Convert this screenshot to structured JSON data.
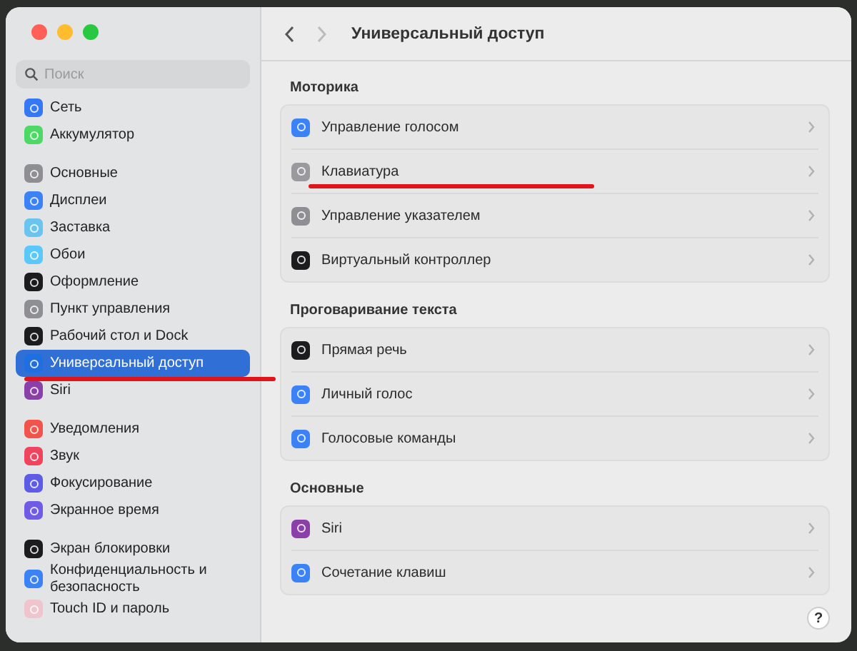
{
  "window": {
    "title": "Универсальный доступ"
  },
  "nav": {
    "back_disabled": false,
    "forward_disabled": true
  },
  "sidebar": {
    "search": {
      "placeholder": "Поиск"
    },
    "groups": [
      [
        {
          "label": "Сеть",
          "selected": false,
          "underlined": false,
          "color": "#3478f6"
        },
        {
          "label": "Аккумулятор",
          "selected": false,
          "underlined": false,
          "color": "#4cd964"
        }
      ],
      [
        {
          "label": "Основные",
          "selected": false,
          "underlined": false,
          "color": "#8e8e93"
        },
        {
          "label": "Дисплеи",
          "selected": false,
          "underlined": false,
          "color": "#3b82f6"
        },
        {
          "label": "Заставка",
          "selected": false,
          "underlined": false,
          "color": "#6ac4f0"
        },
        {
          "label": "Обои",
          "selected": false,
          "underlined": false,
          "color": "#5ac8fa"
        },
        {
          "label": "Оформление",
          "selected": false,
          "underlined": false,
          "color": "#1c1c1e"
        },
        {
          "label": "Пункт управления",
          "selected": false,
          "underlined": false,
          "color": "#8e8e93"
        },
        {
          "label": "Рабочий стол и Dock",
          "selected": false,
          "underlined": false,
          "color": "#1c1c1e"
        },
        {
          "label": "Универсальный доступ",
          "selected": true,
          "underlined": true,
          "color": "#1f6fe0"
        },
        {
          "label": "Siri",
          "selected": false,
          "underlined": false,
          "color": "#8b3fa8"
        }
      ],
      [
        {
          "label": "Уведомления",
          "selected": false,
          "underlined": false,
          "color": "#f2534b"
        },
        {
          "label": "Звук",
          "selected": false,
          "underlined": false,
          "color": "#f0435e"
        },
        {
          "label": "Фокусирование",
          "selected": false,
          "underlined": false,
          "color": "#5e5ce6"
        },
        {
          "label": "Экранное время",
          "selected": false,
          "underlined": false,
          "color": "#6e5ce6"
        }
      ],
      [
        {
          "label": "Экран блокировки",
          "selected": false,
          "underlined": false,
          "color": "#1c1c1e"
        },
        {
          "label": "Конфиденциальность и безопасность",
          "selected": false,
          "underlined": false,
          "color": "#3b82f6"
        },
        {
          "label": "Touch ID и пароль",
          "selected": false,
          "underlined": false,
          "color": "#f0c4cc"
        }
      ]
    ]
  },
  "sections": [
    {
      "title": "Моторика",
      "rows": [
        {
          "label": "Управление голосом",
          "underlined": false,
          "color": "#3b82f6"
        },
        {
          "label": "Клавиатура",
          "underlined": true,
          "color": "#9a9a9e"
        },
        {
          "label": "Управление указателем",
          "underlined": false,
          "color": "#8e8e93"
        },
        {
          "label": "Виртуальный контроллер",
          "underlined": false,
          "color": "#1c1c1e"
        }
      ]
    },
    {
      "title": "Проговаривание текста",
      "rows": [
        {
          "label": "Прямая речь",
          "underlined": false,
          "color": "#1c1c1e"
        },
        {
          "label": "Личный голос",
          "underlined": false,
          "color": "#3b82f6"
        },
        {
          "label": "Голосовые команды",
          "underlined": false,
          "color": "#3b82f6"
        }
      ]
    },
    {
      "title": "Основные",
      "rows": [
        {
          "label": "Siri",
          "underlined": false,
          "color": "#8b3fa8"
        },
        {
          "label": "Сочетание клавиш",
          "underlined": false,
          "color": "#3b82f6"
        }
      ]
    }
  ],
  "help_button": "?"
}
